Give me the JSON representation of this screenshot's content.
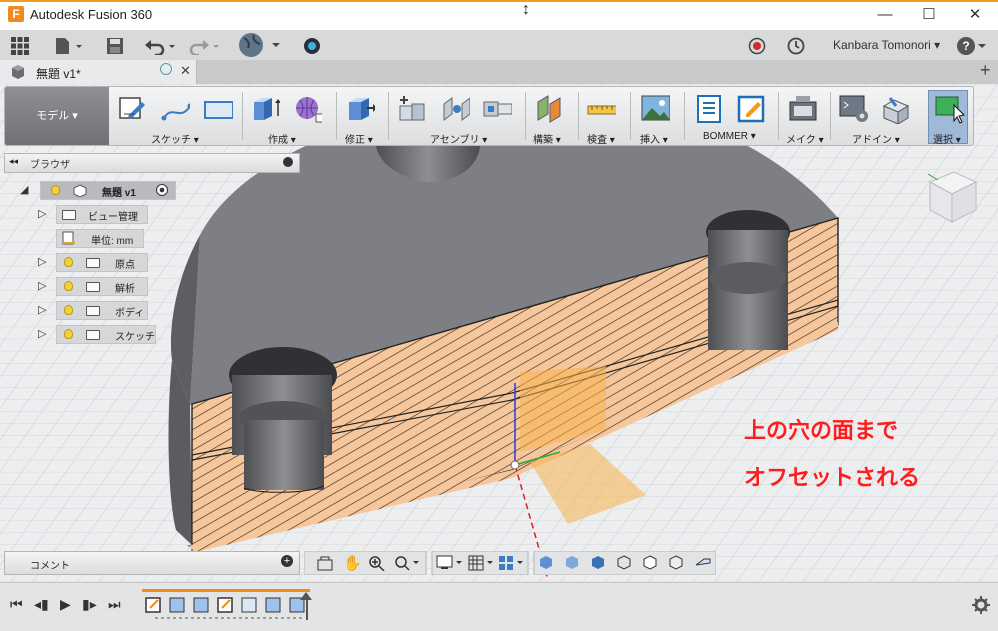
{
  "window": {
    "title": "Autodesk Fusion 360",
    "app_logo": "F",
    "minimize": "—",
    "maximize": "☐",
    "close": "✕"
  },
  "qat": {
    "user": "Kanbara Tomonori ▾",
    "help": "?"
  },
  "document_tab": {
    "label": "無題 v1*",
    "close": "✕",
    "add": "+"
  },
  "toolbar": {
    "workspace": "モデル ▾",
    "groups": {
      "sketch": "スケッチ ▾",
      "create": "作成 ▾",
      "modify": "修正 ▾",
      "assemble": "アセンブリ ▾",
      "construct": "構築 ▾",
      "inspect": "検査 ▾",
      "insert": "挿入 ▾",
      "bommer": "BOMMER ▾",
      "make": "メイク ▾",
      "addins": "アドイン ▾",
      "select": "選択 ▾"
    }
  },
  "browser": {
    "title": "ブラウザ",
    "root": "無題 v1",
    "items": [
      {
        "label": "ビュー管理"
      },
      {
        "label": "単位: mm"
      },
      {
        "label": "原点"
      },
      {
        "label": "解析"
      },
      {
        "label": "ボディ"
      },
      {
        "label": "スケッチ"
      }
    ]
  },
  "comment": {
    "label": "コメント",
    "add": "+"
  },
  "annotation": {
    "line1": "上の穴の面まで",
    "line2": "オフセットされる"
  },
  "colors": {
    "accent": "#f29b1d",
    "hatch": "#f6c79c",
    "body": "#7a7c80",
    "annotation": "#ff1c1c",
    "offset_plane": "#f7b34c"
  }
}
